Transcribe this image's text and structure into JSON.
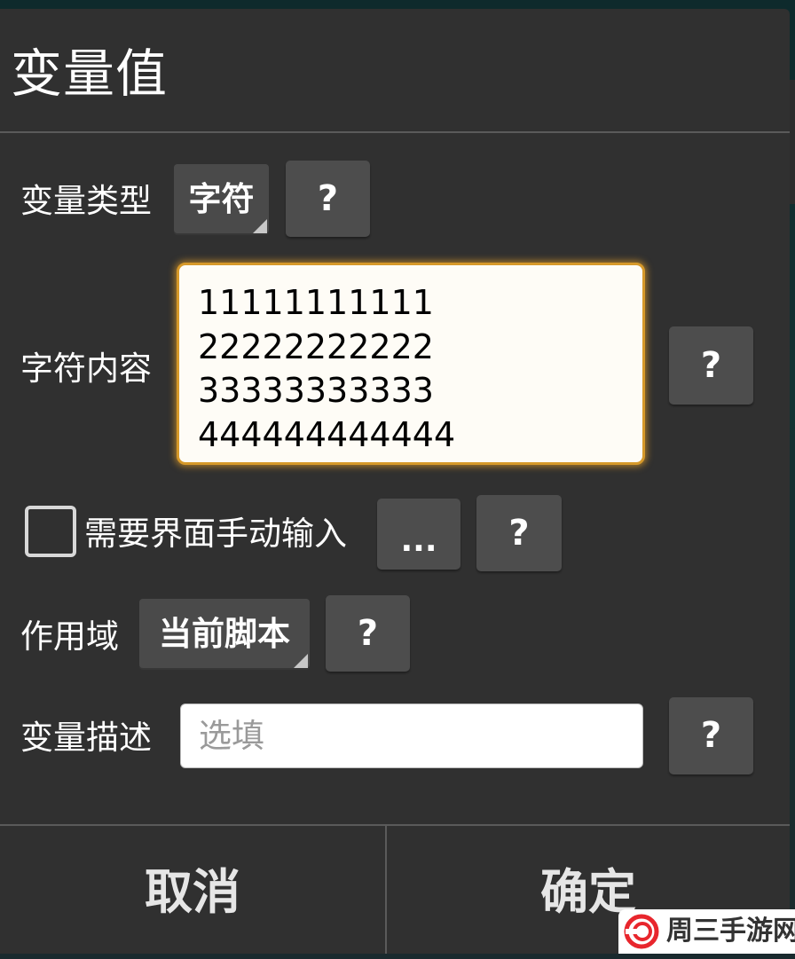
{
  "dialog": {
    "title": "变量值"
  },
  "variable_type": {
    "label": "变量类型",
    "selected": "字符",
    "help": "?"
  },
  "char_content": {
    "label": "字符内容",
    "lines": [
      "11111111111",
      "22222222222",
      "33333333333",
      "444444444444"
    ],
    "help": "?"
  },
  "manual_input": {
    "label": "需要界面手动输入",
    "checked": false,
    "more": "...",
    "help": "?"
  },
  "scope": {
    "label": "作用域",
    "selected": "当前脚本",
    "help": "?"
  },
  "description": {
    "label": "变量描述",
    "placeholder": "选填",
    "value": "",
    "help": "?"
  },
  "footer": {
    "cancel": "取消",
    "confirm": "确定"
  },
  "watermark": {
    "text": "周三手游网",
    "logo_color": "#e8262d"
  }
}
